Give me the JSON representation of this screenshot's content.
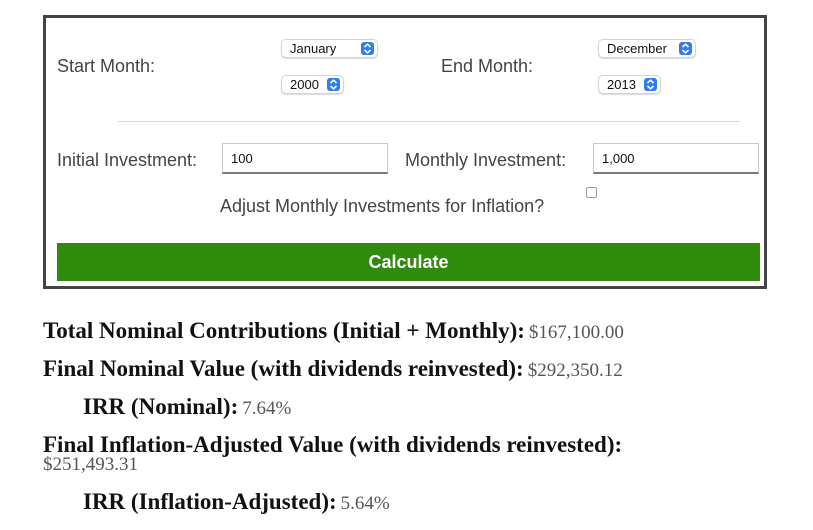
{
  "form": {
    "start_month_label": "Start Month:",
    "start_month_value": "January",
    "start_year_value": "2000",
    "end_month_label": "End Month:",
    "end_month_value": "December",
    "end_year_value": "2013",
    "initial_investment_label": "Initial Investment:",
    "initial_investment_value": "100",
    "monthly_investment_label": "Monthly Investment:",
    "monthly_investment_value": "1,000",
    "adjust_inflation_label": "Adjust Monthly Investments for Inflation?",
    "adjust_inflation_checked": false,
    "calculate_label": "Calculate"
  },
  "results": {
    "total_contrib_label": "Total Nominal Contributions (Initial + Monthly):",
    "total_contrib_value": "$167,100.00",
    "final_nominal_label": "Final Nominal Value (with dividends reinvested):",
    "final_nominal_value": "$292,350.12",
    "irr_nominal_label": "IRR (Nominal):",
    "irr_nominal_value": "7.64%",
    "final_inflation_label": "Final Inflation-Adjusted Value (with dividends reinvested):",
    "final_inflation_value": "$251,493.31",
    "irr_inflation_label": "IRR (Inflation-Adjusted):",
    "irr_inflation_value": "5.64%"
  },
  "colors": {
    "button_green": "#2e8b0c",
    "select_arrow_blue": "#2f7cf6",
    "box_border": "#444444"
  }
}
